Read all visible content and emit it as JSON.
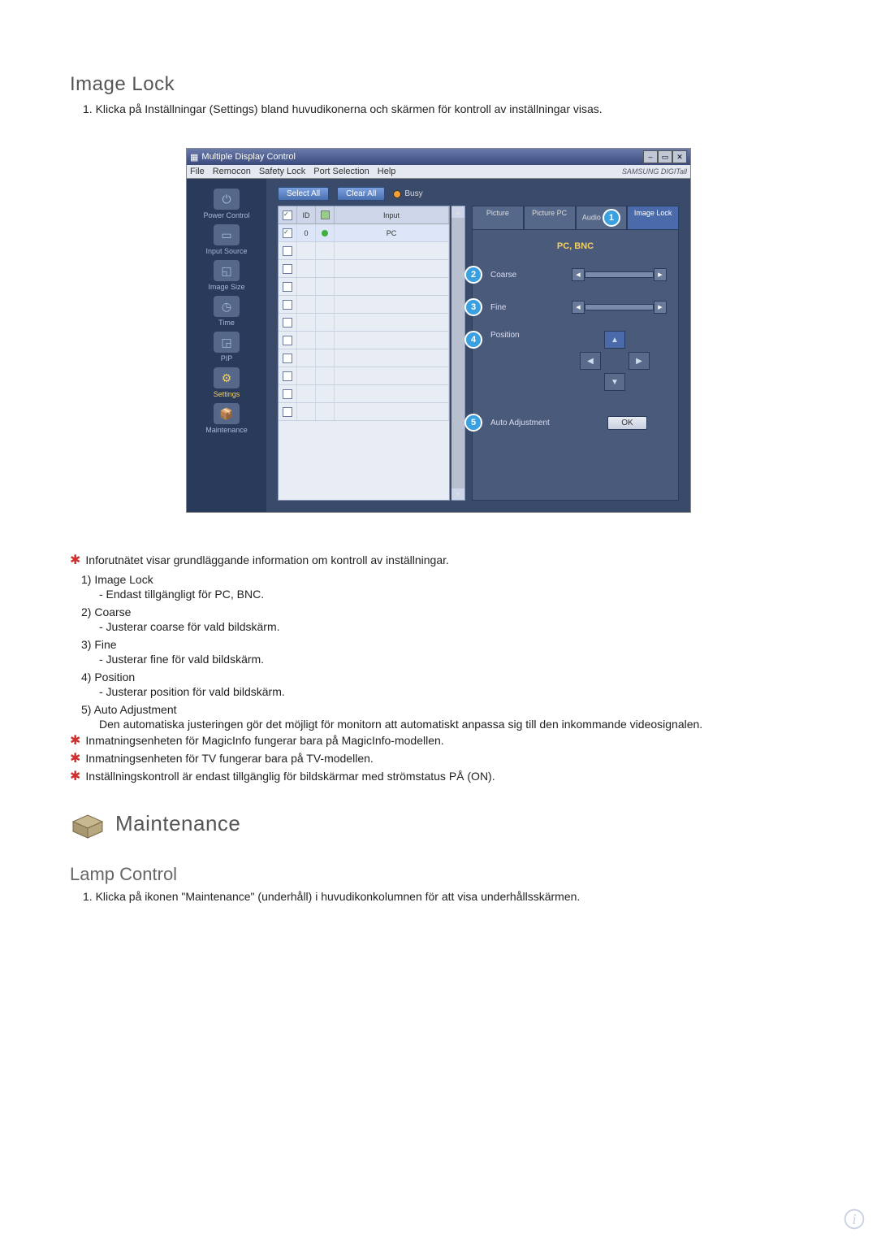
{
  "section1": {
    "title": "Image Lock",
    "instruction": "1.  Klicka på Inställningar (Settings) bland huvudikonerna och skärmen för kontroll av inställningar visas."
  },
  "app": {
    "window_title": "Multiple Display Control",
    "menubar": [
      "File",
      "Remocon",
      "Safety Lock",
      "Port Selection",
      "Help"
    ],
    "brand": "SAMSUNG DIGITall",
    "sidebar": [
      {
        "label": "Power Control"
      },
      {
        "label": "Input Source"
      },
      {
        "label": "Image Size"
      },
      {
        "label": "Time"
      },
      {
        "label": "PIP"
      },
      {
        "label": "Settings",
        "active": true
      },
      {
        "label": "Maintenance"
      }
    ],
    "buttons": {
      "select_all": "Select All",
      "clear_all": "Clear All",
      "busy": "Busy"
    },
    "grid": {
      "headers": [
        "",
        "ID",
        "",
        "Input"
      ],
      "rows": [
        {
          "checked": true,
          "id": "0",
          "status": "green",
          "input": "PC"
        },
        {
          "checked": false
        },
        {
          "checked": false
        },
        {
          "checked": false
        },
        {
          "checked": false
        },
        {
          "checked": false
        },
        {
          "checked": false
        },
        {
          "checked": false
        },
        {
          "checked": false
        },
        {
          "checked": false
        },
        {
          "checked": false
        }
      ]
    },
    "tabs": [
      "Picture",
      "Picture PC",
      "Audio",
      "Image Lock"
    ],
    "active_tab_badge": "1",
    "panel": {
      "title": "PC, BNC",
      "coarse": {
        "badge": "2",
        "label": "Coarse"
      },
      "fine": {
        "badge": "3",
        "label": "Fine"
      },
      "position": {
        "badge": "4",
        "label": "Position"
      },
      "auto": {
        "badge": "5",
        "label": "Auto Adjustment",
        "ok": "OK"
      }
    }
  },
  "notes": {
    "star1": "Inforutnätet visar grundläggande information om kontroll av inställningar.",
    "n1": "1)  Image Lock",
    "n1s": "- Endast tillgängligt för PC, BNC.",
    "n2": "2)  Coarse",
    "n2s": "- Justerar coarse för vald bildskärm.",
    "n3": "3)  Fine",
    "n3s": "- Justerar fine för vald bildskärm.",
    "n4": "4)  Position",
    "n4s": "- Justerar position för vald bildskärm.",
    "n5": "5)  Auto Adjustment",
    "n5s": "Den automatiska justeringen gör det möjligt för monitorn att automatiskt anpassa sig till den inkommande videosignalen.",
    "star2": "Inmatningsenheten för MagicInfo fungerar bara på MagicInfo-modellen.",
    "star3": "Inmatningsenheten för TV fungerar bara på TV-modellen.",
    "star4": "Inställningskontroll är endast tillgänglig för bildskärmar med strömstatus PÅ (ON)."
  },
  "maintenance": {
    "heading": "Maintenance",
    "sub": "Lamp Control",
    "instr": "1.  Klicka på ikonen \"Maintenance\" (underhåll) i huvudikonkolumnen för att visa underhållsskärmen."
  }
}
